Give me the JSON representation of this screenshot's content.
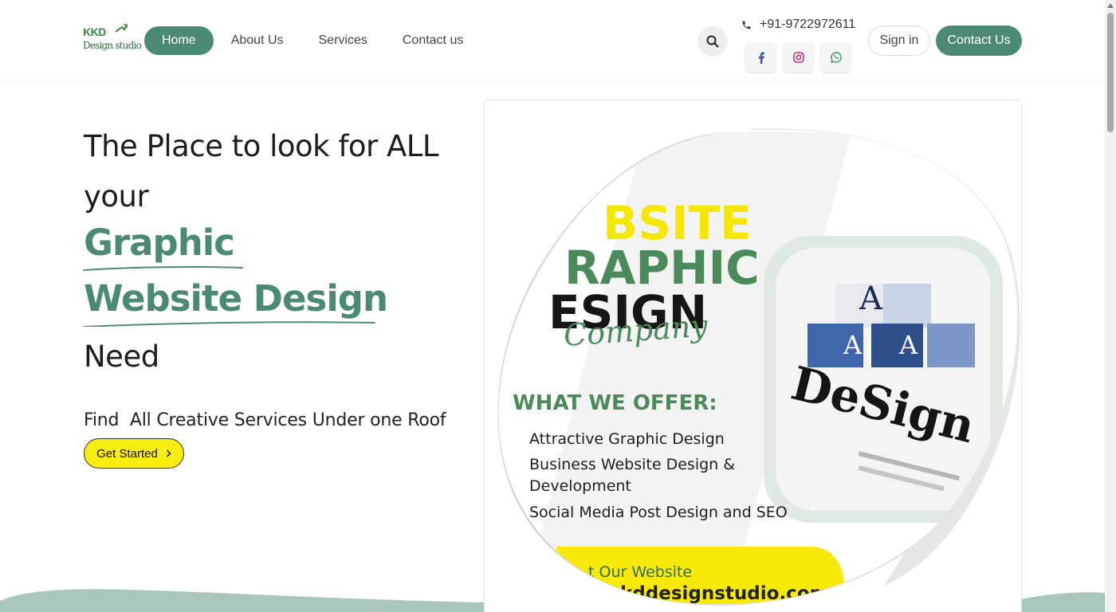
{
  "logo": {
    "line1": "KKD",
    "line2": "Design studio"
  },
  "nav": [
    {
      "label": "Home",
      "active": true
    },
    {
      "label": "About Us",
      "active": false
    },
    {
      "label": "Services",
      "active": false
    },
    {
      "label": "Contact us",
      "active": false
    }
  ],
  "header": {
    "phone": "+91-9722972611",
    "search_icon": "search-icon",
    "phone_icon": "phone-icon",
    "social_icons": [
      "facebook-icon",
      "instagram-icon",
      "whatsapp-icon"
    ],
    "signin_label": "Sign in",
    "contact_label": "Contact Us"
  },
  "hero": {
    "line1": "The Place to look for ALL",
    "line2": "your",
    "accent1": "Graphic",
    "accent2": "Website Design",
    "line3": "Need",
    "subtitle": "Find  All Creative Services Under one Roof",
    "cta_label": "Get Started",
    "accent_color": "#4b8a72",
    "cta_color": "#f7ed10"
  },
  "card_image": {
    "headline1": "BSITE",
    "headline2": "RAPHIC",
    "headline3": "ESIGN",
    "script": "Company",
    "offer_title": "WHAT WE OFFER:",
    "offers": [
      "Attractive Graphic Design",
      "Business Website Design &",
      "Development",
      "Social Media Post Design and SEO"
    ],
    "banner1": "t Our Website",
    "banner2": "kddesignstudio.com",
    "design_word": "DeSign",
    "tile_letter": "A"
  }
}
